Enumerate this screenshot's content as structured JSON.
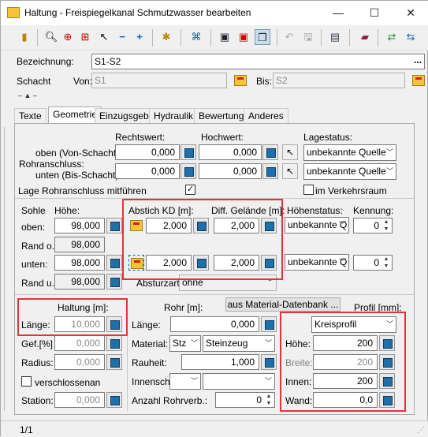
{
  "window": {
    "title": "Haltung - Freispiegelkanal Schmutzwasser bearbeiten",
    "minimize": "—",
    "maximize": "☐",
    "close": "✕"
  },
  "header": {
    "bezeichnung_label": "Bezeichnung:",
    "bezeichnung_value": "S1-S2",
    "ellipsis": "...",
    "schacht_label": "Schacht",
    "von_label": "Von:",
    "von_value": "S1",
    "bis_label": "Bis:",
    "bis_value": "S2"
  },
  "tabs": [
    "Texte",
    "Geometrie",
    "Einzugsgeb.",
    "Hydraulik",
    "Bewertung",
    "Anderes"
  ],
  "coords": {
    "rechtswert_label": "Rechtswert:",
    "hochwert_label": "Hochwert:",
    "lagestatus_label": "Lagestatus:",
    "oben_label": "oben (Von-Schacht):",
    "rohranschluss_label": "Rohranschluss:",
    "unten_label": "unten (Bis-Schacht):",
    "oben_rechts": "0,000",
    "oben_hoch": "0,000",
    "unten_rechts": "0,000",
    "unten_hoch": "0,000",
    "lagestatus_oben": "unbekannte Quelle",
    "lagestatus_unten": "unbekannte Quelle",
    "lage_mitfuehren_label": "Lage Rohranschluss mitführen",
    "verkehrsraum_label": "im Verkehrsraum"
  },
  "sohle": {
    "sohle_label": "Sohle",
    "hoehe_label": "Höhe:",
    "abstich_label": "Abstich KD [m]:",
    "diff_label": "Diff. Gelände [m]:",
    "hoehenstatus_label": "Höhenstatus:",
    "kennung_label": "Kennung:",
    "oben_label": "oben:",
    "oben_value": "98,000",
    "abstich_oben": "2,000",
    "diff_oben": "2,000",
    "status_oben": "unbekannte Q",
    "kennung_oben": "0",
    "rando_label": "Rand o.:",
    "rando_value": "98,000",
    "unten_label": "unten:",
    "unten_value": "98,000",
    "abstich_unten": "2,000",
    "diff_unten": "2,000",
    "status_unten": "unbekannte Q",
    "kennung_unten": "0",
    "randu_label": "Rand u.:",
    "randu_value": "98,000",
    "absturzart_label": "Absturzart:",
    "absturzart_value": "ohne"
  },
  "haltung": {
    "title": "Haltung [m]:",
    "laenge_label": "Länge:",
    "laenge_value": "10,000",
    "gef_label": "Gef.[%]",
    "gef_value": "0,000",
    "radius_label": "Radius:",
    "radius_value": "0,000",
    "verschlossen_label": "verschlossen",
    "an_label": "an",
    "station_label": "Station:",
    "station_value": "0,000"
  },
  "rohr": {
    "title": "Rohr [m]:",
    "material_db_button": "aus Material-Datenbank ...",
    "laenge_label": "Länge:",
    "laenge_value": "0,000",
    "material_label": "Material:",
    "material_code": "Stz",
    "material_name": "Steinzeug",
    "rauheit_label": "Rauheit:",
    "rauheit_value": "1,000",
    "innensch_label": "Innensch.:",
    "innensch_value": "",
    "innensch_value2": "",
    "anzahl_label": "Anzahl Rohrverb.:",
    "anzahl_value": "0"
  },
  "profil": {
    "title": "Profil [mm]:",
    "type": "Kreisprofil",
    "hoehe_label": "Höhe:",
    "hoehe_value": "200",
    "breite_label": "Breite:",
    "breite_value": "200",
    "innen_label": "Innen:",
    "innen_value": "200",
    "wand_label": "Wand:",
    "wand_value": "0,0"
  },
  "status": {
    "page": "1/1"
  }
}
